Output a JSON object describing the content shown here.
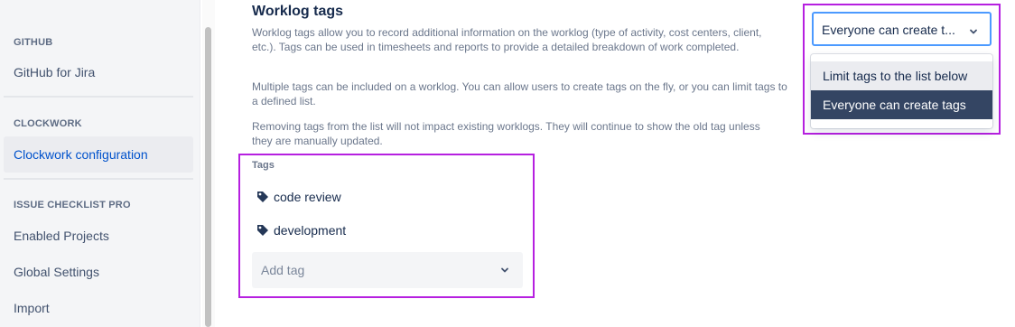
{
  "sidebar": {
    "sections": [
      {
        "header": "GITHUB",
        "items": [
          {
            "label": "GitHub for Jira"
          }
        ]
      },
      {
        "header": "CLOCKWORK",
        "items": [
          {
            "label": "Clockwork configuration",
            "active": true
          }
        ]
      },
      {
        "header": "ISSUE CHECKLIST PRO",
        "items": [
          {
            "label": "Enabled Projects"
          },
          {
            "label": "Global Settings"
          },
          {
            "label": "Import"
          }
        ]
      }
    ]
  },
  "main": {
    "title": "Worklog tags",
    "paragraphs": [
      "Worklog tags allow you to record additional information on the worklog (type of activity, cost centers, client, etc.). Tags can be used in timesheets and reports to provide a detailed breakdown of work completed.",
      "Multiple tags can be included on a worklog. You can allow users to create tags on the fly, or you can limit tags to a defined list.",
      "Removing tags from the list will not impact existing worklogs. They will continue to show the old tag unless they are manually updated."
    ],
    "tags_label": "Tags",
    "tags": [
      "code review",
      "development"
    ],
    "add_tag_placeholder": "Add tag"
  },
  "tag_mode_select": {
    "value": "Everyone can create t...",
    "options": [
      "Limit tags to the list below",
      "Everyone can create tags"
    ],
    "selected_index": 1,
    "hovered_index": 0
  },
  "colors": {
    "accent_link": "#0052cc",
    "highlight_border": "#b620e0",
    "selected_option_bg": "#344563",
    "focus_border": "#4c9aff"
  }
}
